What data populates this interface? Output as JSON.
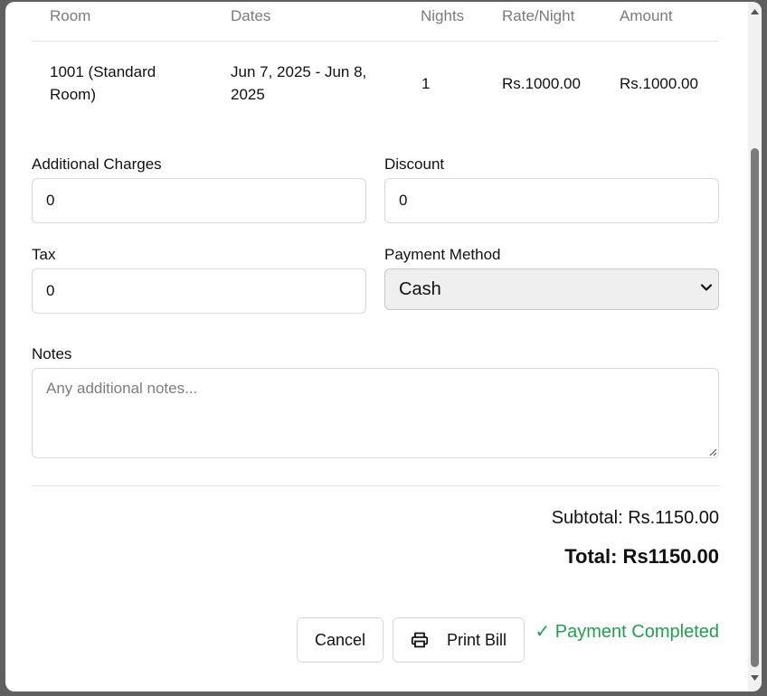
{
  "table": {
    "headers": [
      "Room",
      "Dates",
      "Nights",
      "Rate/Night",
      "Amount"
    ],
    "row": {
      "room_line1": "1001 (Standard",
      "room_line2": "Room)",
      "dates_line1": "Jun 7, 2025 - Jun 8,",
      "dates_line2": "2025",
      "nights": "1",
      "rate": "Rs.1000.00",
      "amount": "Rs.1000.00"
    }
  },
  "form": {
    "additional_charges_label": "Additional Charges",
    "additional_charges_value": "0",
    "discount_label": "Discount",
    "discount_value": "0",
    "tax_label": "Tax",
    "tax_value": "0",
    "payment_method_label": "Payment Method",
    "payment_method_value": "Cash",
    "notes_label": "Notes",
    "notes_placeholder": "Any additional notes..."
  },
  "summary": {
    "subtotal": "Subtotal: Rs.1150.00",
    "total": "Total: Rs1150.00"
  },
  "actions": {
    "cancel_label": "Cancel",
    "print_label": "Print Bill",
    "status_text": "✓ Payment Completed"
  },
  "colors": {
    "status_green": "#1ca24a",
    "overlay": "#5f5f5f"
  },
  "icons": [
    "printer-icon",
    "chevron-down-icon",
    "resize-grip-icon",
    "scroll-up-icon",
    "scroll-down-icon"
  ]
}
